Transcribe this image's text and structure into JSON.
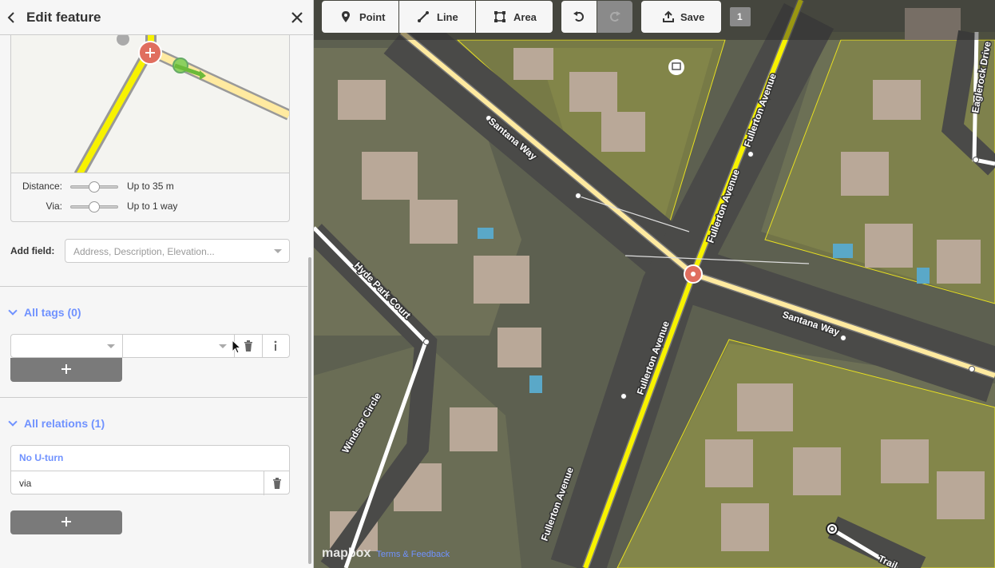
{
  "sidebar": {
    "title": "Edit feature",
    "restriction": {
      "distance_label": "Distance:",
      "distance_value": "Up to 35 m",
      "via_label": "Via:",
      "via_value": "Up to 1 way"
    },
    "add_field": {
      "label": "Add field:",
      "placeholder": "Address, Description, Elevation..."
    },
    "tags_section": {
      "title": "All tags (0)"
    },
    "relations_section": {
      "title": "All relations (1)",
      "relation_name": "No U-turn",
      "relation_role": "via"
    }
  },
  "toolbar": {
    "point_label": "Point",
    "line_label": "Line",
    "area_label": "Area",
    "save_label": "Save",
    "save_count": "1"
  },
  "map": {
    "street_labels": {
      "santana_way_1": "Santana Way",
      "santana_way_2": "Santana Way",
      "fullerton_1": "Fullerton Avenue",
      "fullerton_2": "Fullerton Avenue",
      "fullerton_3": "Fullerton Avenue",
      "fullerton_4": "Fullerton Avenue",
      "hyde_park": "Hyde Park Court",
      "windsor": "Windsor Circle",
      "eaglerock": "Eaglerock Drive",
      "trail": "Trail"
    },
    "attribution": {
      "logo": "mapbox",
      "links": "Terms & Feedback"
    }
  },
  "colors": {
    "accent": "#7092ff",
    "road_yellow": "#f7f200",
    "road_fill": "#ffeaa0",
    "vertex_red": "#e06e5f"
  }
}
